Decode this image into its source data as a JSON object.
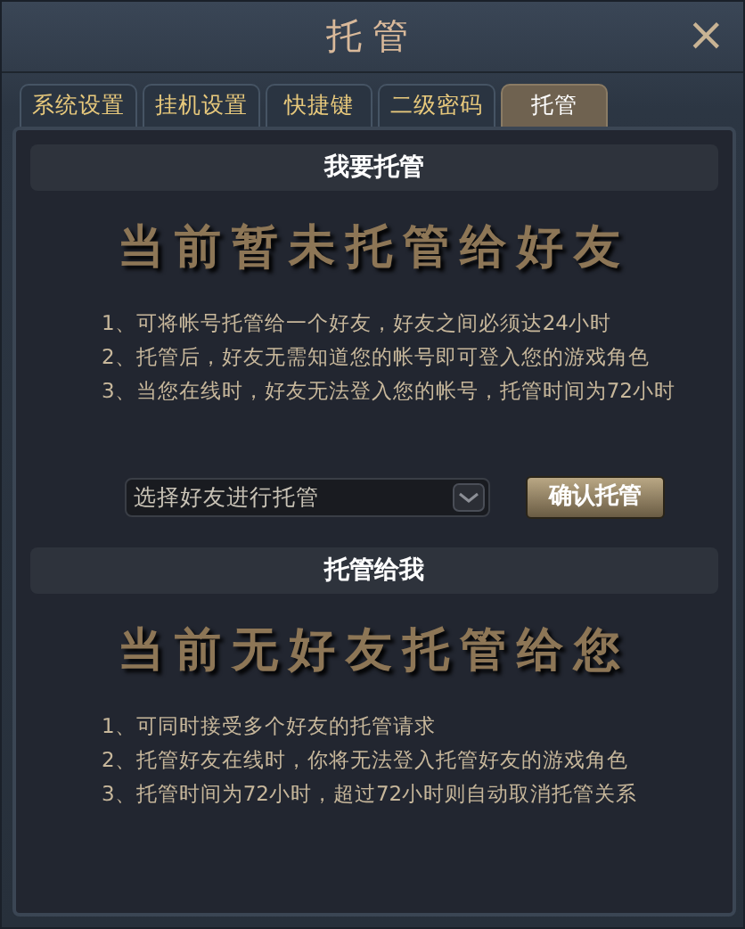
{
  "window": {
    "title": "托管",
    "close": "×"
  },
  "tabs": [
    {
      "label": "系统设置",
      "selected": false
    },
    {
      "label": "挂机设置",
      "selected": false
    },
    {
      "label": "快捷键",
      "selected": false
    },
    {
      "label": "二级密码",
      "selected": false
    },
    {
      "label": "托管",
      "selected": true
    }
  ],
  "sections": [
    {
      "header": "我要托管",
      "status": "当前暂未托管给好友",
      "notes": [
        "1、可将帐号托管给一个好友，好友之间必须达24小时",
        "2、托管后，好友无需知道您的帐号即可登入您的游戏角色",
        "3、当您在线时，好友无法登入您的帐号，托管时间为72小时"
      ],
      "select": {
        "placeholder": "选择好友进行托管"
      },
      "button": "确认托管"
    },
    {
      "header": "托管给我",
      "status": "当前无好友托管给您",
      "notes": [
        "1、可同时接受多个好友的托管请求",
        "2、托管好友在线时，你将无法登入托管好友的游戏角色",
        "3、托管时间为72小时，超过72小时则自动取消托管关系"
      ]
    }
  ]
}
